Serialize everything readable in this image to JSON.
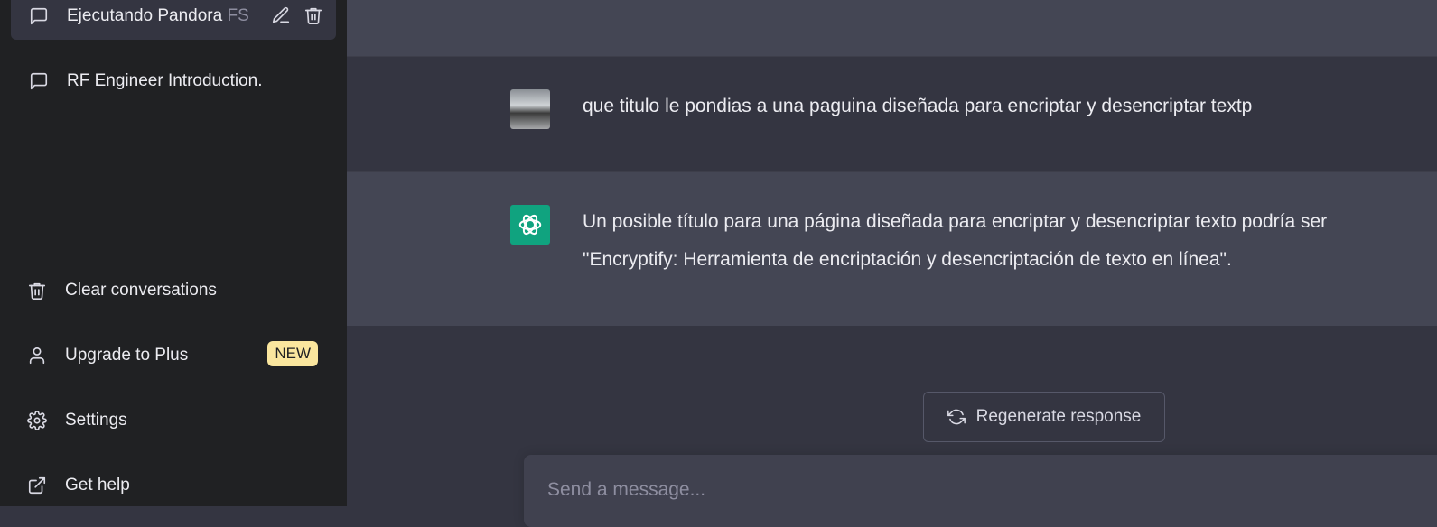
{
  "sidebar": {
    "conversations": [
      {
        "label_main": "Ejecutando Pandora ",
        "label_fade": "FS",
        "active": true
      },
      {
        "label": "RF Engineer Introduction."
      }
    ],
    "menu": {
      "clear": "Clear conversations",
      "upgrade": "Upgrade to Plus",
      "upgrade_badge": "NEW",
      "settings": "Settings",
      "help": "Get help"
    }
  },
  "chat": {
    "user_message": "que titulo le pondias a una paguina diseñada para encriptar y desencriptar textp",
    "assistant_message_line1": "Un posible título para una página diseñada para encriptar y desencriptar texto podría ser",
    "assistant_message_line2": "\"Encryptify: Herramienta de encriptación y desencriptación de texto en línea\"."
  },
  "regenerate_label": "Regenerate response",
  "input": {
    "placeholder": "Send a message..."
  },
  "colors": {
    "sidebar_bg": "#202123",
    "main_bg": "#343541",
    "assistant_bg": "#444654",
    "gpt_green": "#10a37f",
    "badge": "#fae69e"
  }
}
